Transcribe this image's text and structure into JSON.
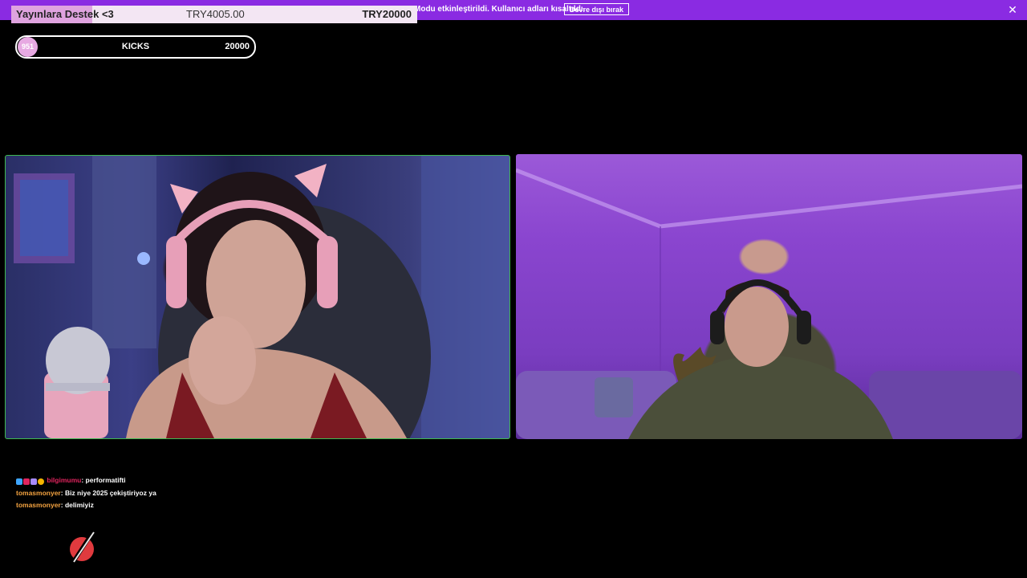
{
  "notice": {
    "text": "Modu etkinleştirildi. Kullanıcı adları kısaltıldı.",
    "button_label": "Devre dışı bırak",
    "close_icon": "close-icon",
    "color": "#8a2be2"
  },
  "goal": {
    "title": "Yayınlara Destek <3",
    "current": "TRY4005.00",
    "target": "TRY20000",
    "progress": 0.2,
    "fill_color": "#dfa3df",
    "bg_color": "#f3e6f3"
  },
  "kicks": {
    "count": "951",
    "label": "KICKS",
    "goal": "20000"
  },
  "chat": {
    "messages": [
      {
        "user": "bilgimumu",
        "text": ": performatifti",
        "badges": true
      },
      {
        "user": "tomasmonyer",
        "text": ": Biz niye 2025 çekiştiriyoz ya",
        "badges": false
      },
      {
        "user": "tomasmonyer",
        "text": ": delimiyiz",
        "badges": false
      }
    ]
  },
  "logo": {
    "icon": "slash-logo-icon",
    "color": "#e03a3e"
  }
}
